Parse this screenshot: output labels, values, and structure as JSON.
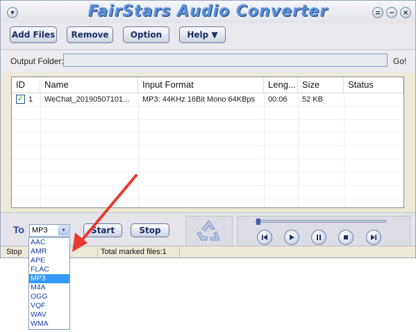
{
  "window": {
    "title": "FairStars Audio Converter",
    "menu_icon": "chevron-down-icon",
    "controls": [
      "minimize-icon",
      "maximize-icon",
      "close-icon"
    ]
  },
  "toolbar": {
    "add_files": "Add Files",
    "remove": "Remove",
    "option": "Option",
    "help": "Help ▼"
  },
  "output": {
    "label": "Output Folder:",
    "value": "",
    "go": "Go!"
  },
  "table": {
    "columns": [
      "ID",
      "Name",
      "Input Format",
      "Leng...",
      "Size",
      "Status"
    ],
    "rows": [
      {
        "checked": true,
        "id": "1",
        "name": "WeChat_20190507101...",
        "format": "MP3: 44KHz 16Bit Mono 64KBps",
        "length": "00:06",
        "size": "52 KB",
        "status": ""
      }
    ]
  },
  "convert": {
    "to_label": "To",
    "selected": "MP3",
    "start": "Start",
    "stop": "Stop",
    "options": [
      "AAC",
      "AMR",
      "APE",
      "FLAC",
      "MP3",
      "M4A",
      "OGG",
      "VQF",
      "WAV",
      "WMA"
    ]
  },
  "player": {
    "progress_fraction": 0,
    "buttons": [
      "skip-back-icon",
      "play-icon",
      "pause-icon",
      "stop-icon",
      "skip-forward-icon"
    ]
  },
  "statusbar": {
    "state": "Stop",
    "total": "Total marked files:1"
  },
  "colors": {
    "title": "#5b8fd4",
    "accent": "#2443a6",
    "selection": "#3399ff",
    "annotation_arrow": "#e8392f"
  }
}
